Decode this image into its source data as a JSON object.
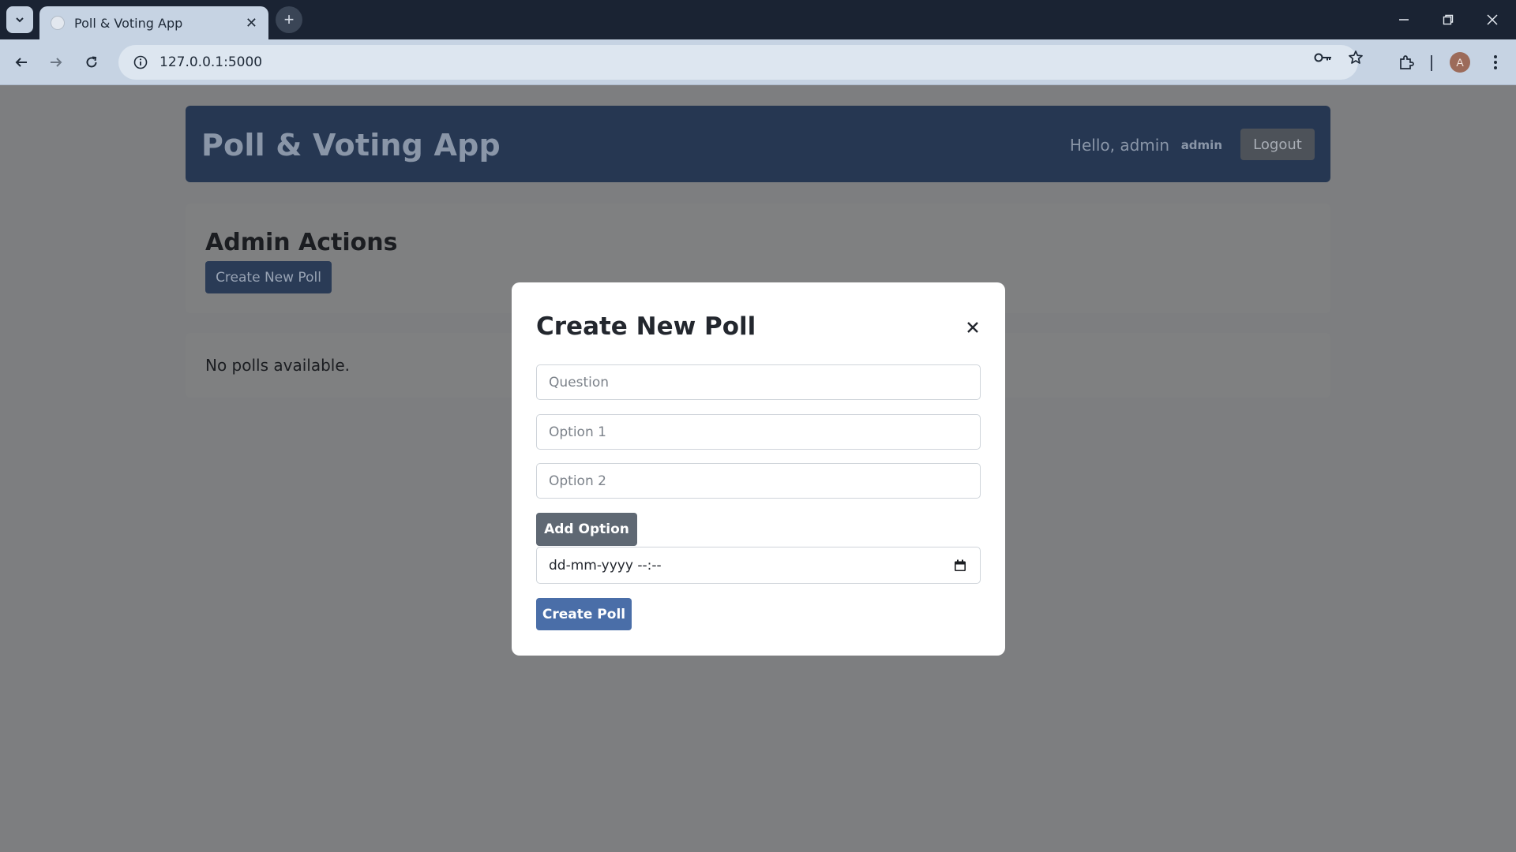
{
  "browser": {
    "tab_title": "Poll & Voting App",
    "url": "127.0.0.1:5000",
    "profile_initial": "A"
  },
  "header": {
    "title": "Poll & Voting App",
    "greeting": "Hello, admin",
    "role": "admin",
    "logout_label": "Logout"
  },
  "admin": {
    "heading": "Admin Actions",
    "create_button_label": "Create New Poll"
  },
  "polls": {
    "empty_text": "No polls available."
  },
  "modal": {
    "title": "Create New Poll",
    "close_symbol": "×",
    "question_placeholder": "Question",
    "option1_placeholder": "Option 1",
    "option2_placeholder": "Option 2",
    "add_option_label": "Add Option",
    "datetime_value": "dd-mm-yyyy --:--",
    "submit_label": "Create Poll"
  },
  "colors": {
    "header_bg": "#263752",
    "primary_button": "#4a6ea8",
    "secondary_button": "#5f6873",
    "overlay": "#7d7e80"
  }
}
